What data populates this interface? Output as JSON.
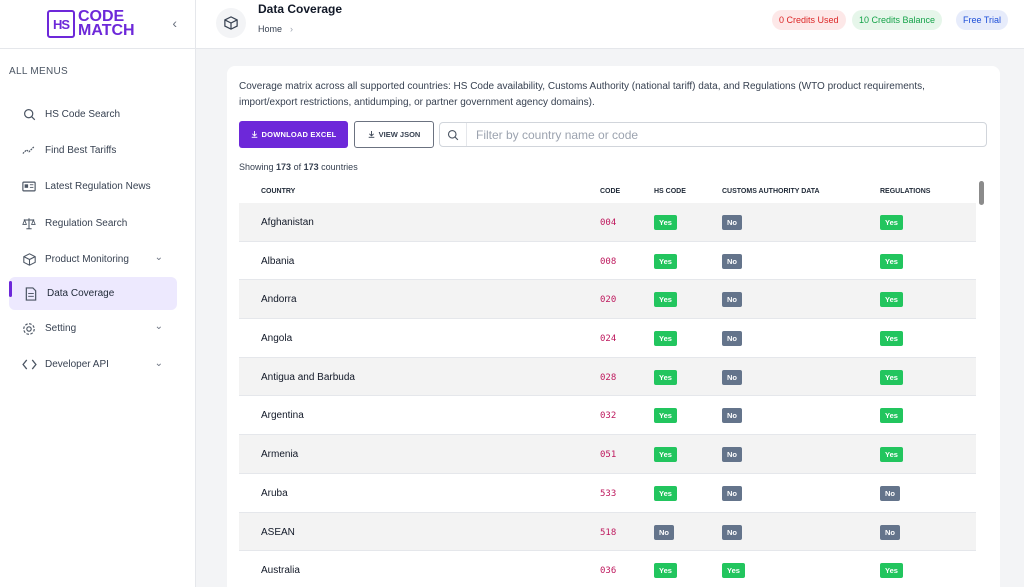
{
  "app": {
    "logo_mark": "HS",
    "logo_line1": "CODE",
    "logo_line2": "MATCH"
  },
  "sidebar": {
    "heading": "ALL MENUS",
    "items": [
      {
        "label": "HS Code Search",
        "icon": "search-icon"
      },
      {
        "label": "Find Best Tariffs",
        "icon": "trend-icon"
      },
      {
        "label": "Latest Regulation News",
        "icon": "news-icon"
      },
      {
        "label": "Regulation Search",
        "icon": "scale-icon"
      },
      {
        "label": "Product Monitoring",
        "icon": "package-icon"
      },
      {
        "label": "Data Coverage",
        "icon": "document-icon"
      },
      {
        "label": "Setting",
        "icon": "gear-icon"
      },
      {
        "label": "Developer API",
        "icon": "code-icon"
      }
    ]
  },
  "header": {
    "title": "Data Coverage",
    "breadcrumb": "Home",
    "credits_used": "0 Credits Used",
    "credits_balance": "10 Credits Balance",
    "plan": "Free Trial"
  },
  "main": {
    "description": "Coverage matrix across all supported countries: HS Code availability, Customs Authority (national tariff) data, and Regulations (WTO product requirements, import/export restrictions, antidumping, or partner government agency domains).",
    "download_label": "DOWNLOAD EXCEL",
    "json_label": "VIEW JSON",
    "search_placeholder": "Filter by country name or code",
    "showing_prefix": "Showing",
    "showing_count": "173",
    "showing_of": "of",
    "showing_total": "173",
    "showing_suffix": "countries",
    "columns": {
      "country": "COUNTRY",
      "code": "CODE",
      "hs": "HS CODE",
      "customs": "CUSTOMS AUTHORITY DATA",
      "regs": "REGULATIONS"
    },
    "rows": [
      {
        "country": "Afghanistan",
        "code": "004",
        "hs": "Yes",
        "customs": "No",
        "regs": "Yes"
      },
      {
        "country": "Albania",
        "code": "008",
        "hs": "Yes",
        "customs": "No",
        "regs": "Yes"
      },
      {
        "country": "Andorra",
        "code": "020",
        "hs": "Yes",
        "customs": "No",
        "regs": "Yes"
      },
      {
        "country": "Angola",
        "code": "024",
        "hs": "Yes",
        "customs": "No",
        "regs": "Yes"
      },
      {
        "country": "Antigua and Barbuda",
        "code": "028",
        "hs": "Yes",
        "customs": "No",
        "regs": "Yes"
      },
      {
        "country": "Argentina",
        "code": "032",
        "hs": "Yes",
        "customs": "No",
        "regs": "Yes"
      },
      {
        "country": "Armenia",
        "code": "051",
        "hs": "Yes",
        "customs": "No",
        "regs": "Yes"
      },
      {
        "country": "Aruba",
        "code": "533",
        "hs": "Yes",
        "customs": "No",
        "regs": "No"
      },
      {
        "country": "ASEAN",
        "code": "518",
        "hs": "No",
        "customs": "No",
        "regs": "No"
      },
      {
        "country": "Australia",
        "code": "036",
        "hs": "Yes",
        "customs": "Yes",
        "regs": "Yes"
      }
    ]
  },
  "colors": {
    "brand": "#6d28d9",
    "yes": "#22c55e",
    "no": "#64748b",
    "code_text": "#be185d"
  }
}
